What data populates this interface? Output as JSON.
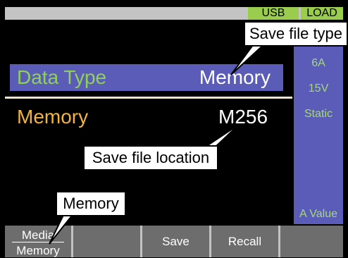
{
  "status": {
    "usb": "USB",
    "load": "LOAD"
  },
  "rows": {
    "data_type": {
      "label": "Data Type",
      "value": "Memory"
    },
    "memory": {
      "label": "Memory",
      "value": "M256"
    }
  },
  "right_panel": {
    "current": "6A",
    "voltage": "15V",
    "mode": "Static",
    "range": "A Value"
  },
  "softkeys": {
    "media_top": "Media",
    "media_bottom": "Memory",
    "key2": "",
    "save": "Save",
    "recall": "Recall",
    "key5": ""
  },
  "callouts": {
    "type": "Save file type",
    "location": "Save file location",
    "memory": "Memory"
  },
  "colors": {
    "highlight_bg": "#5b5cb7",
    "label_green": "#8fd05c",
    "label_orange": "#f2b43c",
    "badge_green": "#9acd4e",
    "softkey_gray": "#6d6d6d"
  }
}
